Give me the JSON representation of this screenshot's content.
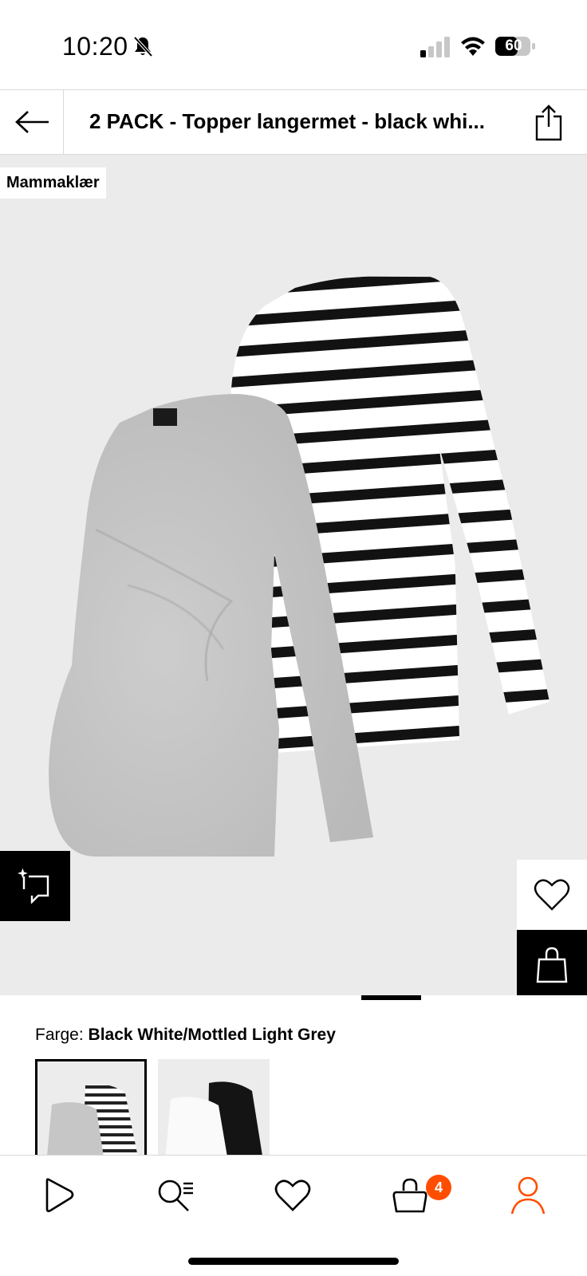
{
  "status_bar": {
    "time": "10:20",
    "battery": "60",
    "icons": [
      "bell-slash-icon",
      "signal-icon",
      "wifi-icon",
      "battery-icon"
    ]
  },
  "header": {
    "title": "2 PACK - Topper langermet - black whi...",
    "back_icon": "arrow-left-icon",
    "share_icon": "share-icon"
  },
  "gallery": {
    "category_tag": "Mammaklær",
    "product_colors": {
      "stripe_dark": "#111111",
      "stripe_light": "#ffffff",
      "grey_top": "#c4c4c4",
      "background": "#ebebeb"
    },
    "pager": {
      "count": 2,
      "active_index": 0
    }
  },
  "color_section": {
    "label": "Farge:",
    "value": "Black White/Mottled Light Grey",
    "swatches": [
      "Black White/Mottled Light Grey",
      "Black/White"
    ]
  },
  "bottom_nav": {
    "items": [
      "home-icon",
      "search-icon",
      "wishlist-icon",
      "bag-icon",
      "profile-icon"
    ],
    "cart_count": "4",
    "accent_color": "#ff4e00"
  }
}
